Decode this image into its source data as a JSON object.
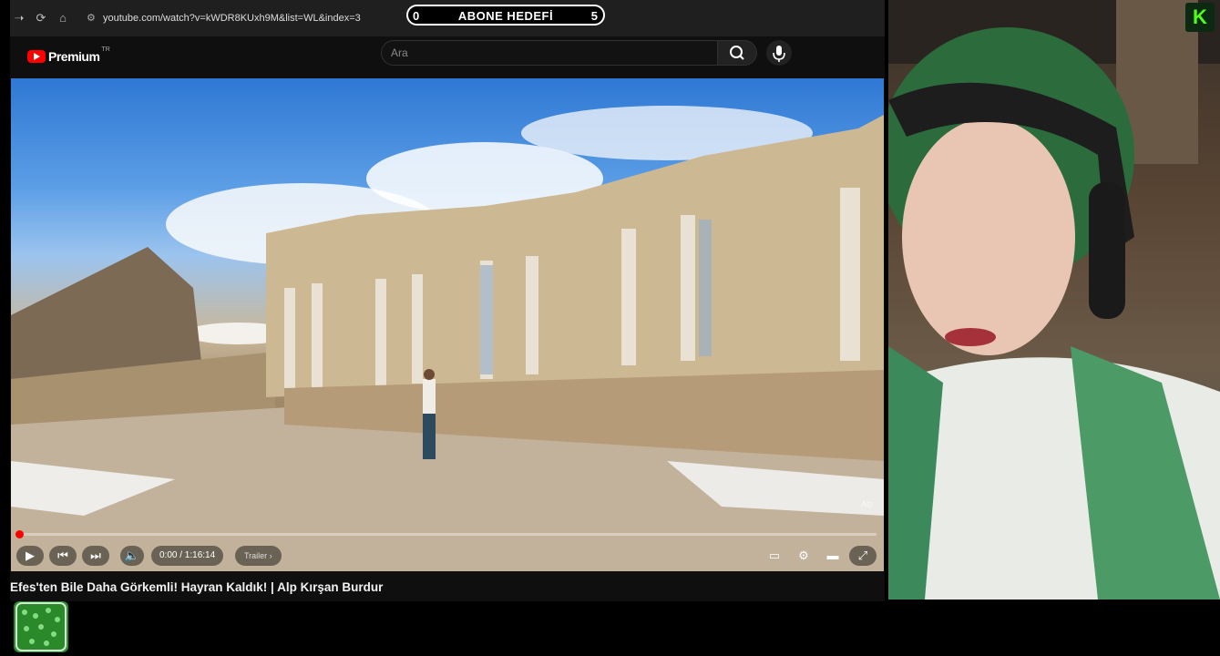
{
  "browser": {
    "url": "youtube.com/watch?v=kWDR8KUxh9M&list=WL&index=3"
  },
  "overlay": {
    "sub_goal": {
      "current": "0",
      "label": "ABONE HEDEFİ",
      "target": "5"
    }
  },
  "youtube": {
    "logo_text": "Premium",
    "region": "TR",
    "search_placeholder": "Ara",
    "video": {
      "title": "Efes'ten Bile Daha Görkemli! Hayran Kaldık! | Alp Kırşan Burdur",
      "time": "0:00 / 1:16:14",
      "chapter": "Trailer",
      "watermark": "Alp",
      "progress": 0.0
    }
  },
  "icons": {
    "back": "arrow-right-icon",
    "reload": "reload-icon",
    "home": "home-icon",
    "site_info": "tune-icon",
    "search": "search-icon",
    "mic": "mic-icon",
    "play": "play-icon",
    "prev": "skip-previous-icon",
    "next": "skip-next-icon",
    "volume": "volume-icon",
    "subtitles": "subtitles-icon",
    "settings": "gear-icon",
    "theater": "theater-icon",
    "fullscreen": "fullscreen-icon",
    "kick": "kick-logo"
  },
  "colors": {
    "youtube_red": "#ff0000",
    "kick_green": "#53fc18",
    "page_bg": "#0f0f0f"
  }
}
